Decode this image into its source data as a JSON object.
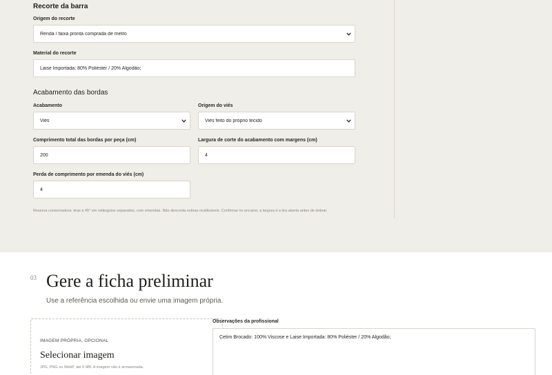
{
  "barra": {
    "section_title": "Recorte da barra",
    "origem_label": "Origem do recorte",
    "origem_value": "Renda / faixa pronta comprada de metro",
    "material_label": "Material do recorte",
    "material_value": "Laise Importada: 80% Poliéster / 20% Algodão;"
  },
  "bordas": {
    "section_title": "Acabamento das bordas",
    "acabamento_label": "Acabamento",
    "acabamento_value": "Viés",
    "origem_vies_label": "Origem do viés",
    "origem_vies_value": "Viés feito do próprio tecido",
    "comprimento_label": "Comprimento total das bordas por peça (cm)",
    "comprimento_value": "200",
    "largura_label": "Largura de corte do acabamento com margens (cm)",
    "largura_value": "4",
    "perda_label": "Perda de comprimento por emenda do viés (cm)",
    "perda_value": "4",
    "note": "Reserva conservadora: tiras a 45° em retângulos separados, com emendas. Não desconta sobras reutilizáveis. Confirmar no encaixe; a largura é a tira aberta antes de dobrar."
  },
  "step": {
    "number": "03",
    "title": "Gere a ficha preliminar",
    "subtitle": "Use a referência escolhida ou envie uma imagem própria."
  },
  "upload": {
    "caption": "IMAGEM PRÓPRIA, OPCIONAL",
    "title": "Selecionar imagem",
    "hint": "JPG, PNG ou WebP, até 6 MB. A imagem não é armazenada."
  },
  "observacoes": {
    "label": "Observações da profissional",
    "value": "Cetim Brocado: 100% Viscose e Laise Importada: 80% Poliéster / 20% Algodão;"
  },
  "icons": {
    "select": "chevron-down-icon"
  }
}
